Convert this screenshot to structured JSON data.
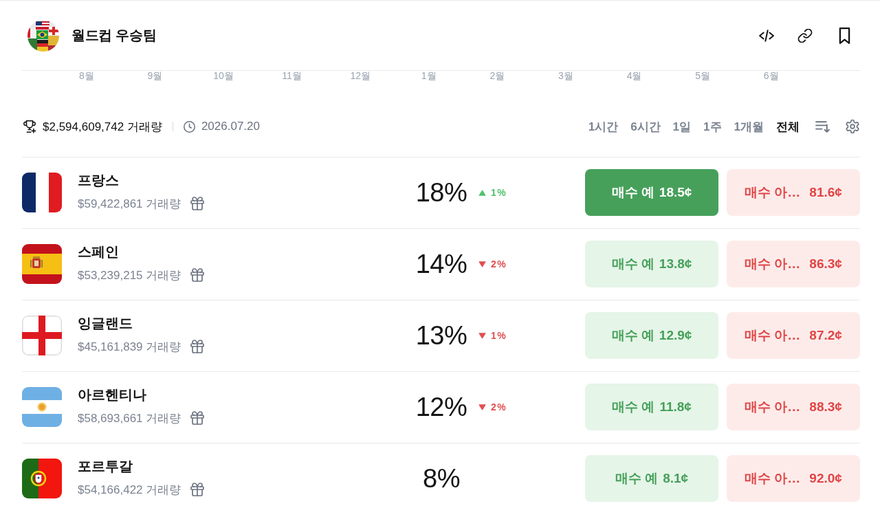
{
  "header": {
    "title": "월드컵 우승팀"
  },
  "timeline_axis": {
    "labels": [
      "8월",
      "9월",
      "10월",
      "11월",
      "12월",
      "1월",
      "2월",
      "3월",
      "4월",
      "5월",
      "6월"
    ]
  },
  "summary": {
    "volume": "$2,594,609,742 거래량",
    "date": "2026.07.20"
  },
  "time_filters": [
    {
      "label": "1시간",
      "selected": false
    },
    {
      "label": "6시간",
      "selected": false
    },
    {
      "label": "1일",
      "selected": false
    },
    {
      "label": "1주",
      "selected": false
    },
    {
      "label": "1개월",
      "selected": false
    },
    {
      "label": "전체",
      "selected": true
    }
  ],
  "outcomes": [
    {
      "name": "프랑스",
      "flag": {
        "kind": "france"
      },
      "volume": "$59,422,861 거래량",
      "probability": "18%",
      "change": {
        "up": true,
        "value": "1%"
      },
      "yes_button": {
        "label": "매수 예",
        "price": "18.5¢",
        "active": true
      },
      "no_button": {
        "label": "매수 아…",
        "price": "81.6¢"
      }
    },
    {
      "name": "스페인",
      "flag": {
        "kind": "spain"
      },
      "volume": "$53,239,215 거래량",
      "probability": "14%",
      "change": {
        "up": false,
        "value": "2%"
      },
      "yes_button": {
        "label": "매수 예",
        "price": "13.8¢",
        "active": false
      },
      "no_button": {
        "label": "매수 아…",
        "price": "86.3¢"
      }
    },
    {
      "name": "잉글랜드",
      "flag": {
        "kind": "england"
      },
      "volume": "$45,161,839 거래량",
      "probability": "13%",
      "change": {
        "up": false,
        "value": "1%"
      },
      "yes_button": {
        "label": "매수 예",
        "price": "12.9¢",
        "active": false
      },
      "no_button": {
        "label": "매수 아…",
        "price": "87.2¢"
      }
    },
    {
      "name": "아르헨티나",
      "flag": {
        "kind": "argentina"
      },
      "volume": "$58,693,661 거래량",
      "probability": "12%",
      "change": {
        "up": false,
        "value": "2%"
      },
      "yes_button": {
        "label": "매수 예",
        "price": "11.8¢",
        "active": false
      },
      "no_button": {
        "label": "매수 아…",
        "price": "88.3¢"
      }
    },
    {
      "name": "포르투갈",
      "flag": {
        "kind": "portugal"
      },
      "volume": "$54,166,422 거래량",
      "probability": "8%",
      "yes_button": {
        "label": "매수 예",
        "price": "8.1¢",
        "active": false
      },
      "no_button": {
        "label": "매수 아…",
        "price": "92.0¢"
      }
    }
  ]
}
